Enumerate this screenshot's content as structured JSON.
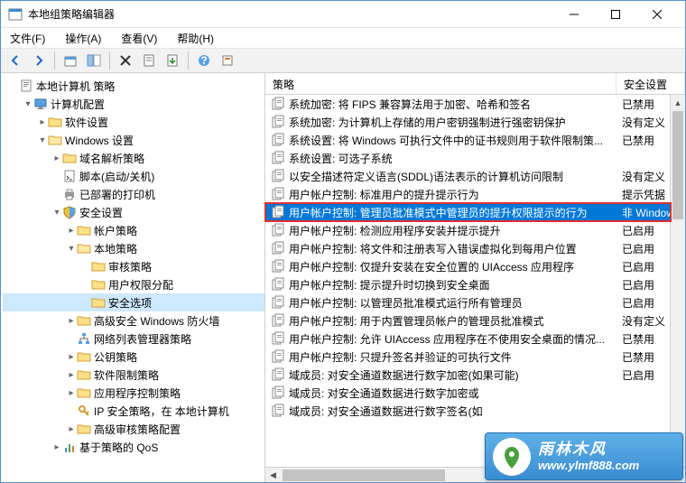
{
  "window": {
    "title": "本地组策略编辑器"
  },
  "menu": {
    "file": "文件(F)",
    "action": "操作(A)",
    "view": "查看(V)",
    "help": "帮助(H)"
  },
  "columns": {
    "policy": "策略",
    "setting": "安全设置"
  },
  "tree": {
    "root": "本地计算机 策略",
    "computer_config": "计算机配置",
    "software_settings": "软件设置",
    "windows_settings": "Windows 设置",
    "name_resolution": "域名解析策略",
    "scripts": "脚本(启动/关机)",
    "deployed_printers": "已部署的打印机",
    "security_settings": "安全设置",
    "account_policies": "帐户策略",
    "local_policies": "本地策略",
    "audit_policy": "审核策略",
    "user_rights": "用户权限分配",
    "security_options": "安全选项",
    "windows_firewall": "高级安全 Windows 防火墙",
    "network_list": "网络列表管理器策略",
    "public_key": "公钥策略",
    "software_restriction": "软件限制策略",
    "app_control": "应用程序控制策略",
    "ip_security": "IP 安全策略，在 本地计算机",
    "advanced_audit": "高级审核策略配置",
    "policy_qos": "基于策略的 QoS"
  },
  "policies": [
    {
      "name": "系统加密: 将 FIPS 兼容算法用于加密、哈希和签名",
      "value": "已禁用"
    },
    {
      "name": "系统加密: 为计算机上存储的用户密钥强制进行强密钥保护",
      "value": "没有定义"
    },
    {
      "name": "系统设置: 将 Windows 可执行文件中的证书规则用于软件限制策...",
      "value": "已禁用"
    },
    {
      "name": "系统设置: 可选子系统",
      "value": ""
    },
    {
      "name": "以安全描述符定义语言(SDDL)语法表示的计算机访问限制",
      "value": "没有定义"
    },
    {
      "name": "用户帐户控制: 标准用户的提升提示行为",
      "value": "提示凭据"
    },
    {
      "name": "用户帐户控制: 管理员批准模式中管理员的提升权限提示的行为",
      "value": "非 Window"
    },
    {
      "name": "用户帐户控制: 检测应用程序安装并提示提升",
      "value": "已启用"
    },
    {
      "name": "用户帐户控制: 将文件和注册表写入错误虚拟化到每用户位置",
      "value": "已启用"
    },
    {
      "name": "用户帐户控制: 仅提升安装在安全位置的 UIAccess 应用程序",
      "value": "已启用"
    },
    {
      "name": "用户帐户控制: 提示提升时切换到安全桌面",
      "value": "已启用"
    },
    {
      "name": "用户帐户控制: 以管理员批准模式运行所有管理员",
      "value": "已启用"
    },
    {
      "name": "用户帐户控制: 用于内置管理员帐户的管理员批准模式",
      "value": "没有定义"
    },
    {
      "name": "用户帐户控制: 允许 UIAccess 应用程序在不使用安全桌面的情况...",
      "value": "已禁用"
    },
    {
      "name": "用户帐户控制: 只提升签名并验证的可执行文件",
      "value": "已禁用"
    },
    {
      "name": "域成员: 对安全通道数据进行数字加密(如果可能)",
      "value": "已启用"
    },
    {
      "name": "域成员: 对安全通道数据进行数字加密或",
      "value": ""
    },
    {
      "name": "域成员: 对安全通道数据进行数字签名(如",
      "value": ""
    }
  ],
  "selectedIndex": 6,
  "watermark": {
    "cn": "雨林木风",
    "url": "www.ylmf888.com"
  }
}
